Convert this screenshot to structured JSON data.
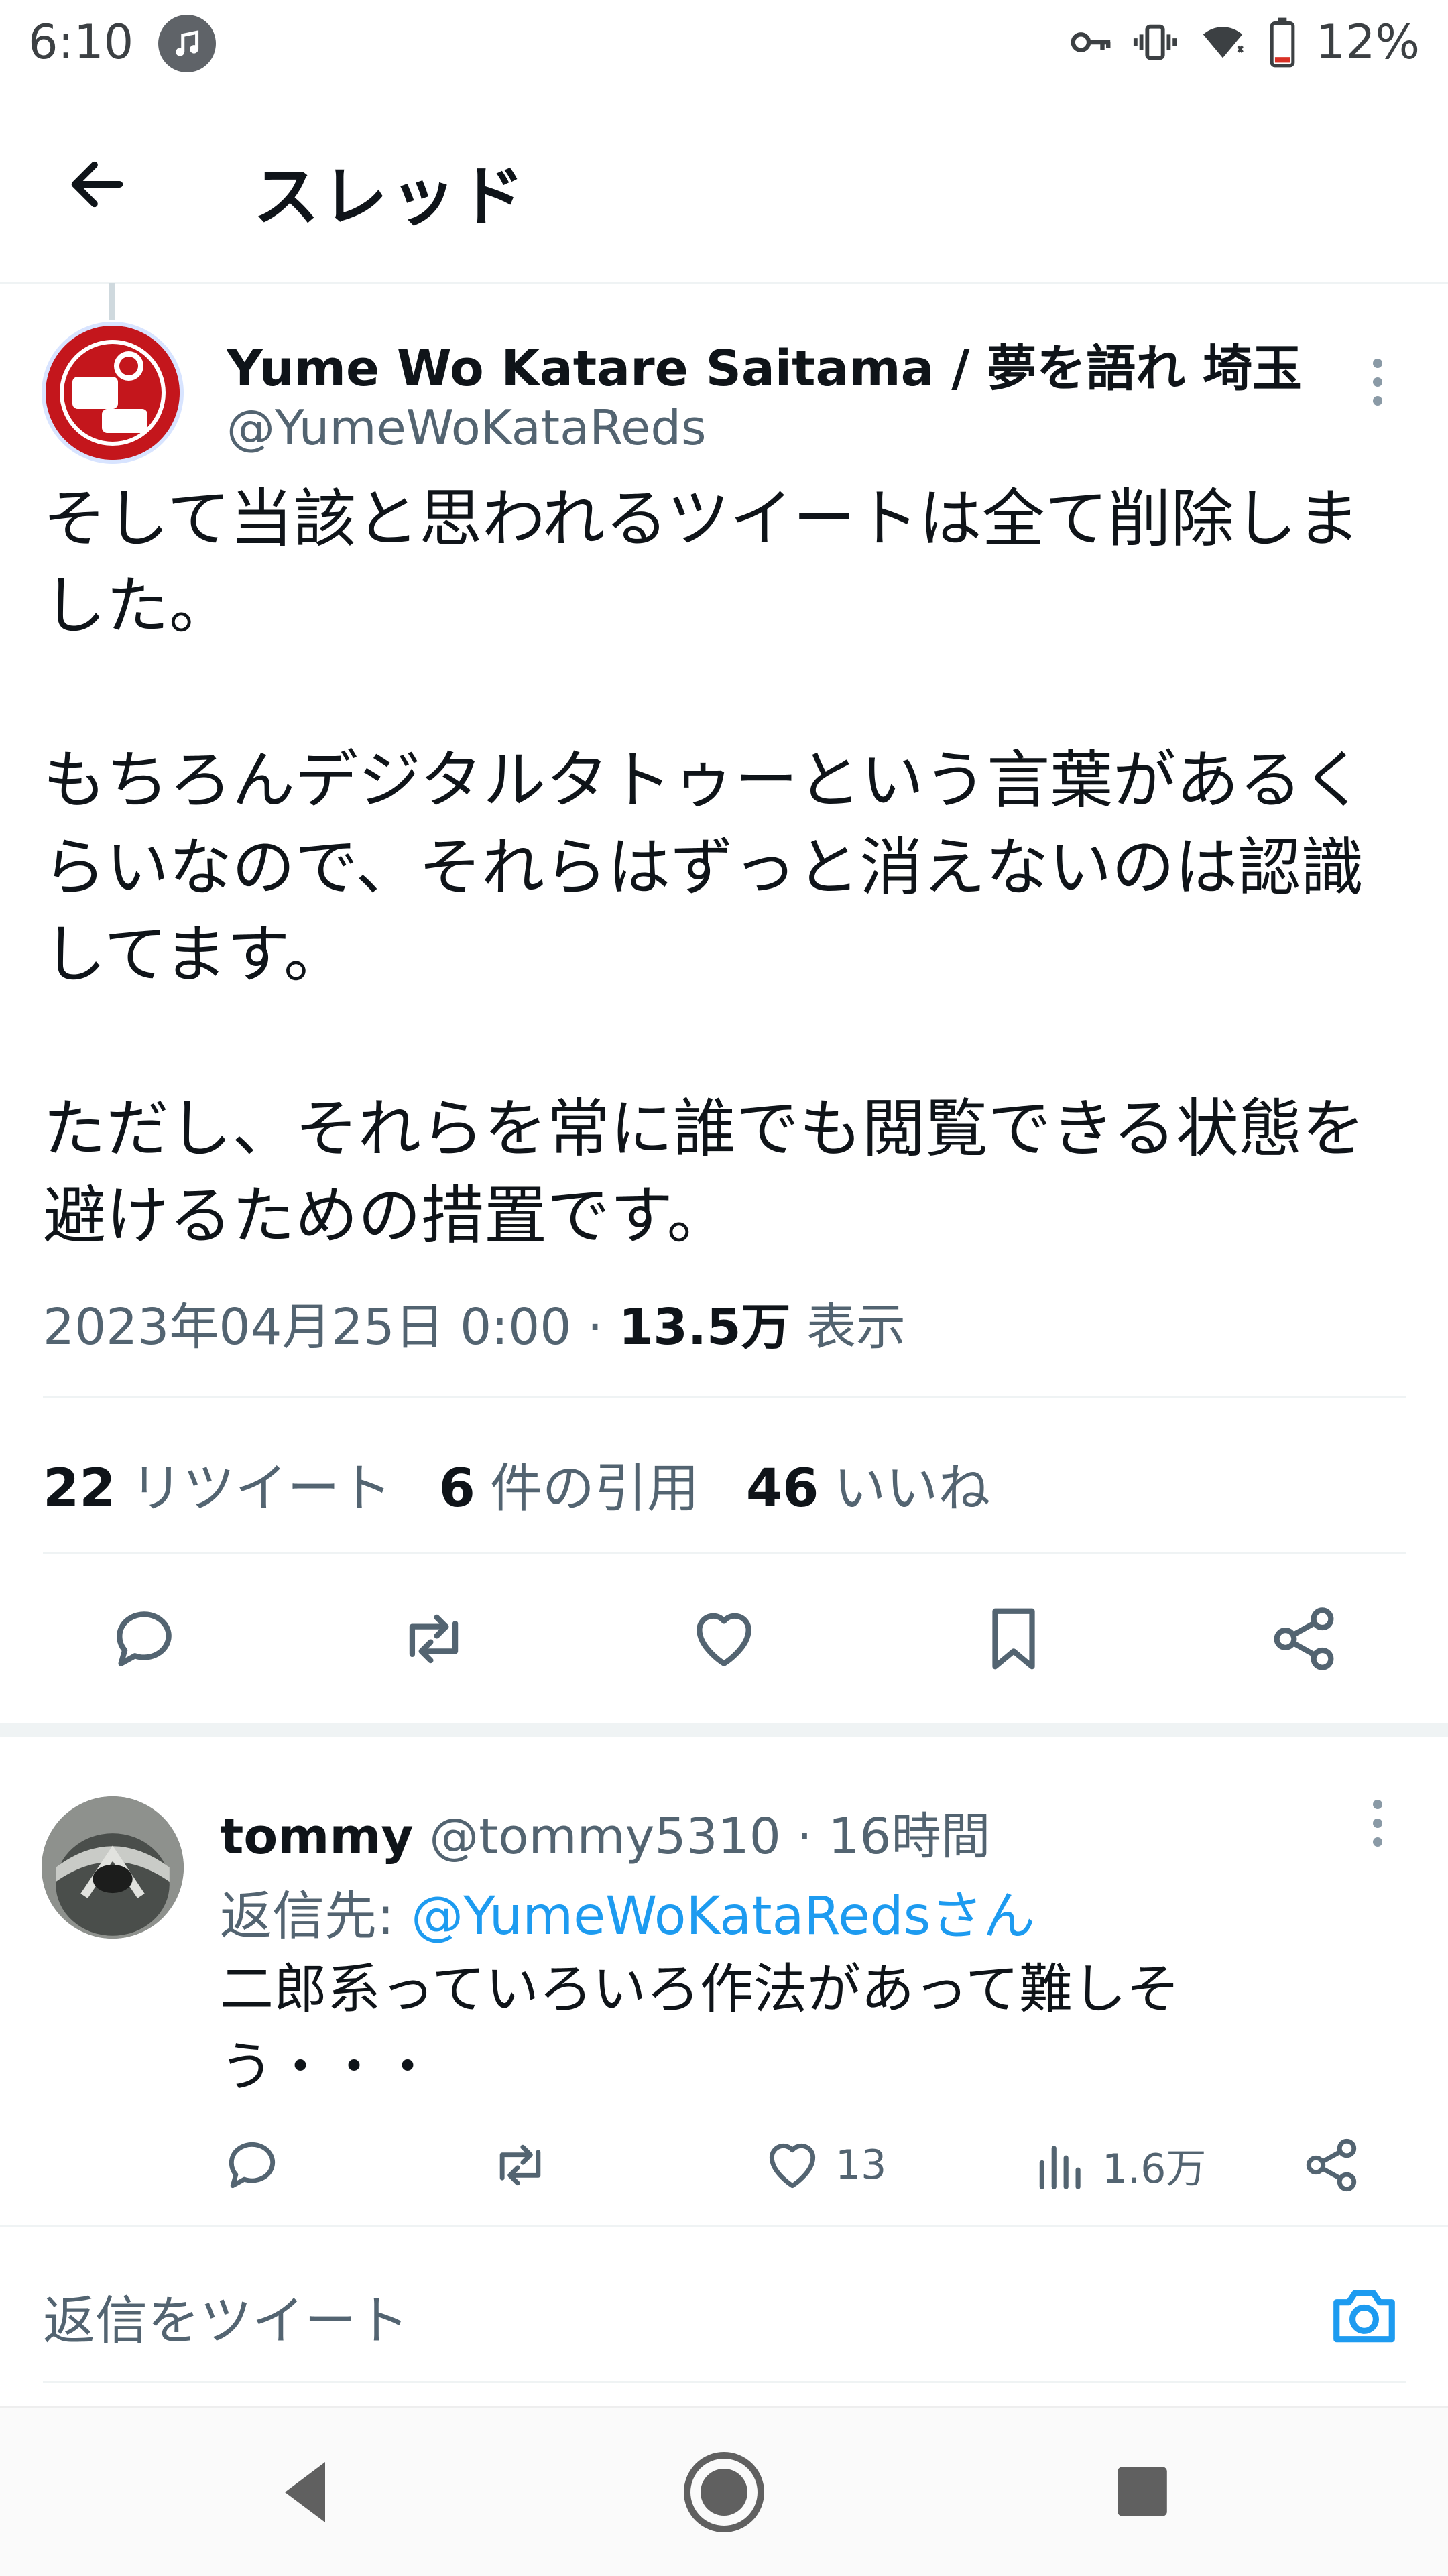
{
  "status": {
    "time": "6:10",
    "battery": "12%"
  },
  "header": {
    "title": "スレッド"
  },
  "tweet": {
    "author_name": "Yume Wo Katare Saitama / 夢を語れ 埼玉",
    "author_handle": "@YumeWoKataReds",
    "text": "そして当該と思われるツイートは全て削除しました。\n\nもちろんデジタルタトゥーという言葉があるくらいなので、それらはずっと消えないのは認識してます。\n\nただし、それらを常に誰でも閲覧できる状態を避けるための措置です。",
    "date": "2023年04月25日 0:00 · ",
    "views_count": "13.5万",
    "views_label": " 表示",
    "stats": {
      "retweets_count": "22",
      "retweets_label": "リツイート",
      "quotes_count": "6",
      "quotes_label": "件の引用",
      "likes_count": "46",
      "likes_label": "いいね"
    }
  },
  "reply": {
    "name": "tommy",
    "handle": " @tommy5310 · 16時間",
    "reply_to_label": "返信先: ",
    "reply_to_link": "@YumeWoKataRedsさん",
    "text": "二郎系っていろいろ作法があって難しそう・・・",
    "likes": "13",
    "views": "1.6万"
  },
  "compose": {
    "placeholder": "返信をツイート"
  },
  "colors": {
    "accent": "#1d9bf0",
    "text": "#0f1419",
    "muted": "#536471"
  }
}
